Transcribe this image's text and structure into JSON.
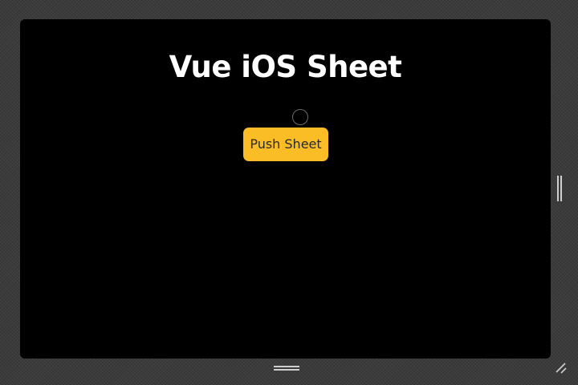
{
  "app": {
    "title": "Vue iOS Sheet",
    "push_button_label": "Push Sheet"
  },
  "colors": {
    "background": "#000000",
    "button": "#fbbd26",
    "button_text": "#2a2a2a",
    "title": "#ffffff",
    "workspace": "#3b3b3b"
  },
  "icons": {
    "vertical_handle": "grip-vertical-icon",
    "horizontal_handle": "grip-horizontal-icon",
    "corner_handle": "resize-corner-icon",
    "cursor": "cursor-ring"
  }
}
